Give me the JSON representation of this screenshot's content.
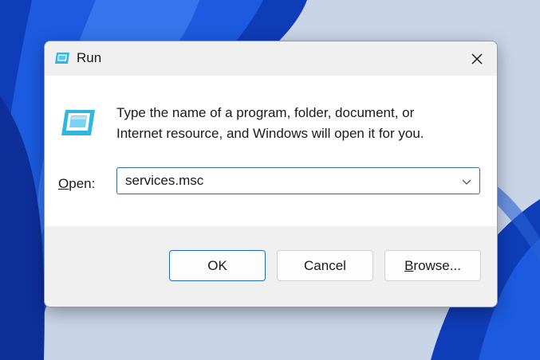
{
  "window": {
    "title": "Run",
    "title_icon": "run-icon",
    "close_icon": "close-icon"
  },
  "content": {
    "description_line1": "Type the name of a program, folder, document, or",
    "description_line2": "Internet resource, and Windows will open it for you.",
    "open_label_mnemonic": "O",
    "open_label_rest": "pen:",
    "open_value": "services.msc"
  },
  "buttons": {
    "ok": "OK",
    "cancel": "Cancel",
    "browse_mnemonic": "B",
    "browse_rest": "rowse..."
  },
  "colors": {
    "accent": "#1f6bb5",
    "dialog_bg": "#ffffff",
    "chrome_bg": "#f0f0f0",
    "wallpaper_blue": "#1546c8"
  }
}
